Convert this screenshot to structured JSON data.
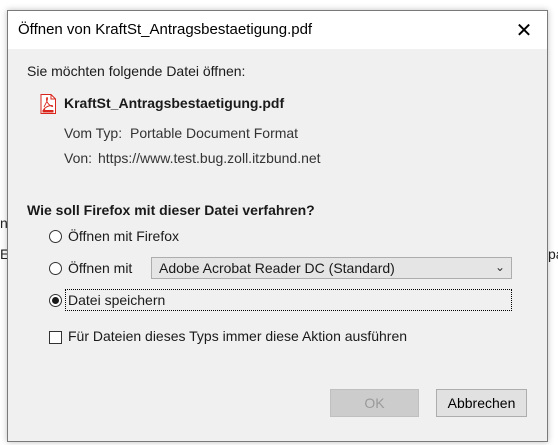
{
  "background": {
    "left_fragments": [
      "n",
      "E"
    ],
    "right_fragment": "pa"
  },
  "dialog": {
    "title": "Öffnen von KraftSt_Antragsbestaetigung.pdf",
    "close_icon": "close-icon",
    "intro": "Sie möchten folgende Datei öffnen:",
    "file": {
      "icon": "pdf-file-icon",
      "name": "KraftSt_Antragsbestaetigung.pdf",
      "type_label": "Vom Typ:",
      "type_value": "Portable Document Format",
      "from_label": "Von:",
      "from_value": "https://www.test.bug.zoll.itzbund.net"
    },
    "question": "Wie soll Firefox mit dieser Datei verfahren?",
    "options": {
      "open_with_firefox": "Öffnen mit Firefox",
      "open_with": "Öffnen mit",
      "open_with_app": "Adobe Acrobat Reader DC (Standard)",
      "save_file": "Datei speichern",
      "selected": "save_file"
    },
    "remember": {
      "label": "Für Dateien dieses Typs immer diese Aktion ausführen",
      "checked": false
    },
    "buttons": {
      "ok": "OK",
      "cancel": "Abbrechen"
    }
  },
  "colors": {
    "dialog_bg": "#f0f0f0",
    "pdf_red": "#d9261c",
    "disabled_button": "#cccccc"
  }
}
